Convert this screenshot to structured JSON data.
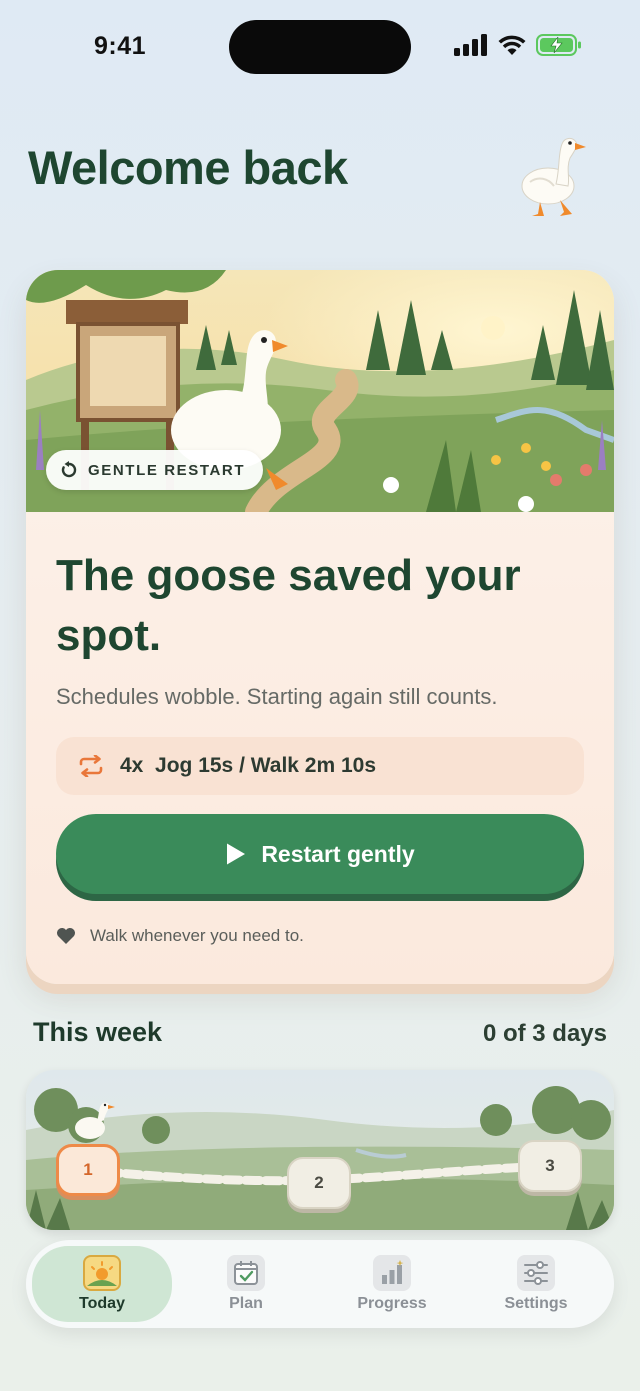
{
  "status_bar": {
    "time": "9:41"
  },
  "header": {
    "title": "Welcome back"
  },
  "card": {
    "badge": "GENTLE RESTART",
    "headline": "The goose saved your spot.",
    "subline": "Schedules wobble. Starting again still counts.",
    "workout": "4x  Jog 15s / Walk 2m 10s",
    "cta_label": "Restart gently",
    "hint": "Walk whenever you need to."
  },
  "week": {
    "title": "This week",
    "count": "0 of 3 days",
    "days": [
      "1",
      "2",
      "3"
    ]
  },
  "tabs": [
    {
      "label": "Today",
      "icon": "sunrise-icon",
      "active": true
    },
    {
      "label": "Plan",
      "icon": "calendar-check-icon",
      "active": false
    },
    {
      "label": "Progress",
      "icon": "bar-chart-icon",
      "active": false
    },
    {
      "label": "Settings",
      "icon": "sliders-icon",
      "active": false
    }
  ],
  "colors": {
    "brand_green": "#3a8b5a",
    "accent_orange": "#ee8a48",
    "title_green": "#1e4630"
  }
}
